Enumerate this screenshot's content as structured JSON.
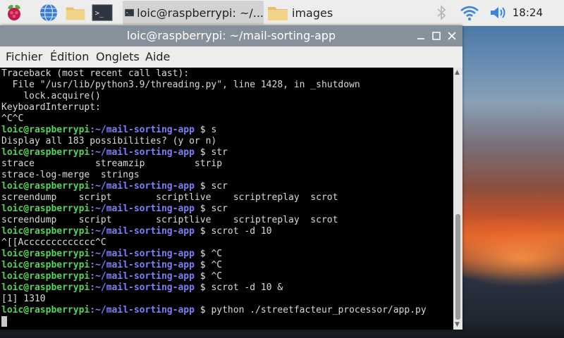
{
  "panel": {
    "tasks": [
      {
        "label": ""
      },
      {
        "label": "loic@raspberrypi: ~/..."
      },
      {
        "label": "images"
      }
    ],
    "clock": "18:24"
  },
  "window": {
    "title": "loic@raspberrypi: ~/mail-sorting-app",
    "menu": [
      "Fichier",
      "Édition",
      "Onglets",
      "Aide"
    ]
  },
  "terminal": {
    "prompt_user": "loic@raspberrypi",
    "prompt_path": ":~/mail-sorting-app",
    "prompt_sign": " $ ",
    "lines": [
      {
        "type": "out",
        "text": "Traceback (most recent call last):"
      },
      {
        "type": "out",
        "text": "  File \"/usr/lib/python3.9/threading.py\", line 1428, in _shutdown"
      },
      {
        "type": "out",
        "text": "    lock.acquire()"
      },
      {
        "type": "out",
        "text": "KeyboardInterrupt:"
      },
      {
        "type": "out",
        "text": "^C^C"
      },
      {
        "type": "cmd",
        "text": "s"
      },
      {
        "type": "out",
        "text": "Display all 183 possibilities? (y or n)"
      },
      {
        "type": "cmd",
        "text": "str"
      },
      {
        "type": "out",
        "text": "strace           streamzip         strip"
      },
      {
        "type": "out",
        "text": "strace-log-merge  strings"
      },
      {
        "type": "cmd",
        "text": "scr"
      },
      {
        "type": "out",
        "text": "screendump    script        scriptlive    scriptreplay  scrot"
      },
      {
        "type": "cmd",
        "text": "scr"
      },
      {
        "type": "out",
        "text": "screendump    script        scriptlive    scriptreplay  scrot"
      },
      {
        "type": "cmd",
        "text": "scrot -d 10"
      },
      {
        "type": "out",
        "text": "^[[Accccccccccccc^C"
      },
      {
        "type": "cmd",
        "text": "^C"
      },
      {
        "type": "cmd",
        "text": "^C"
      },
      {
        "type": "cmd",
        "text": "^C"
      },
      {
        "type": "cmd",
        "text": "scrot -d 10 &"
      },
      {
        "type": "out",
        "text": "[1] 1310"
      },
      {
        "type": "cmd",
        "text": "python ./streetfacteur_processor/app.py"
      },
      {
        "type": "cursor",
        "text": ""
      }
    ]
  },
  "colors": {
    "prompt_user": "#55d455",
    "prompt_path": "#7d7dff",
    "titlebar": "#87919c"
  },
  "icons": {
    "launcher": [
      "raspberry-menu-icon",
      "web-browser-icon",
      "file-manager-icon",
      "terminal-icon"
    ],
    "tray": [
      "bluetooth-icon",
      "wifi-icon",
      "volume-icon"
    ]
  }
}
